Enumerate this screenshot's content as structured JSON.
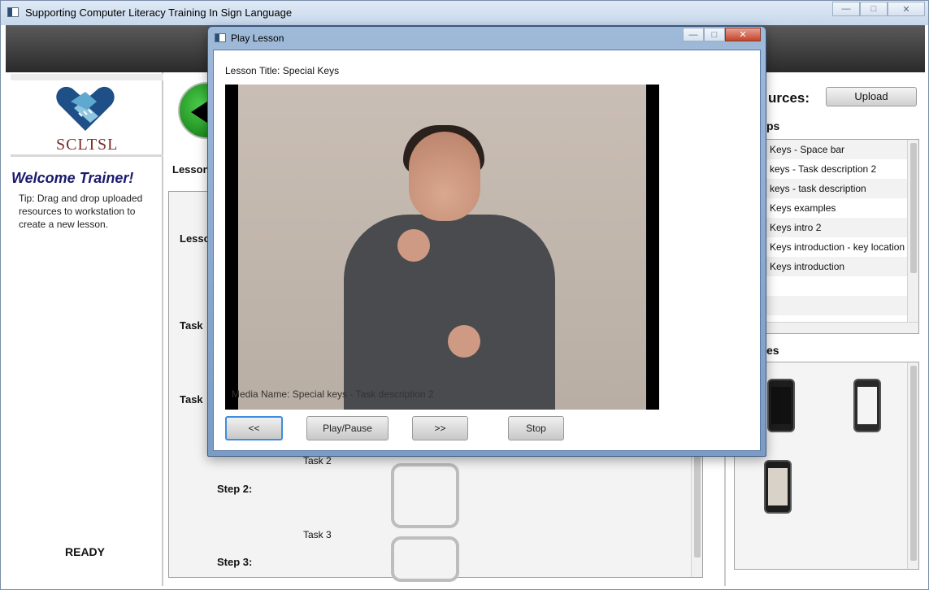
{
  "main_window": {
    "title": "Supporting Computer Literacy Training In Sign Language"
  },
  "window_buttons": {
    "minimize": "—",
    "maximize": "□",
    "close": "✕"
  },
  "left": {
    "logo_text": "SCLTSL",
    "welcome": "Welcome Trainer!",
    "tip": "Tip: Drag and drop uploaded resources to workstation to create a new lesson.",
    "status": "READY"
  },
  "center": {
    "lesson_label": "Lesson",
    "ws_lesson": "Lesso",
    "ws_task1": "Task",
    "ws_task2": "Task",
    "task2_label": "Task 2",
    "task3_label": "Task 3",
    "step2": "Step 2:",
    "step3": "Step 3:"
  },
  "right": {
    "resources_title": "urces:",
    "upload_label": "Upload",
    "clips_label": "ps",
    "media_label": "es",
    "resources": [
      "Keys - Space bar",
      "keys - Task description 2",
      "keys - task description",
      "Keys examples",
      "Keys intro 2",
      "Keys introduction - key location",
      "Keys introduction",
      "",
      ""
    ]
  },
  "dialog": {
    "title": "Play Lesson",
    "lesson_title": "Lesson Title: Special Keys",
    "media_name": "Media Name: Special keys - Task description 2",
    "buttons": {
      "prev": "<<",
      "play_pause": "Play/Pause",
      "next": ">>",
      "stop": "Stop"
    }
  }
}
